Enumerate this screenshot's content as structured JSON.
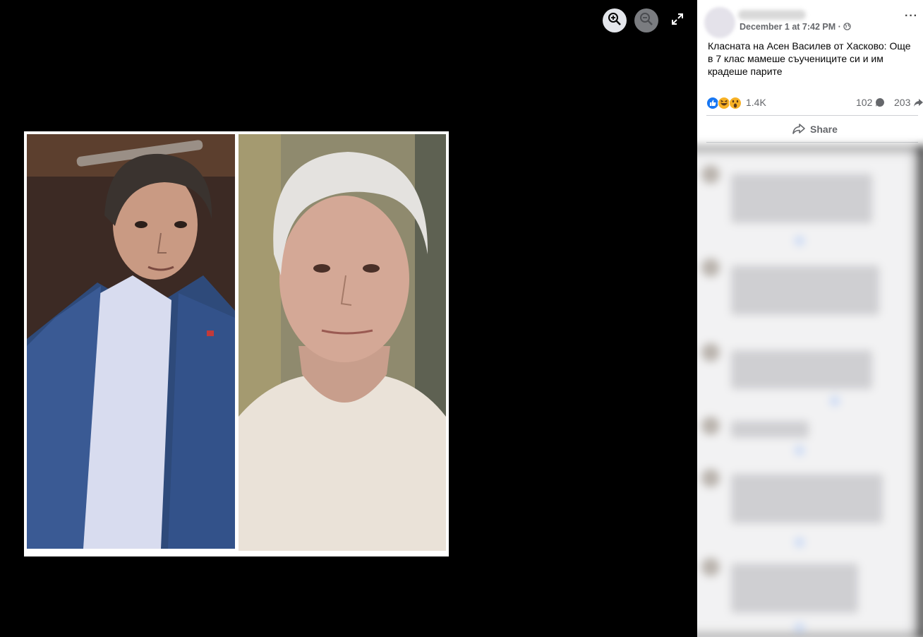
{
  "viewer": {
    "controls": [
      "zoom-in-icon",
      "zoom-out-icon",
      "fullscreen-icon"
    ]
  },
  "post": {
    "date": "December 1 at 7:42 PM",
    "visibility_separator": "·",
    "more_label": "···",
    "text": "Класната на Асен Василев от Хасково: Още в 7 клас мамеше съучениците си и им крадеше парите",
    "reactions": {
      "icons": [
        "like-icon",
        "haha-icon",
        "wow-icon"
      ],
      "count": "1.4K"
    },
    "comments_count": "102",
    "shares_count": "203",
    "share_label": "Share"
  },
  "colors": {
    "background": "#000000",
    "sidebar": "#ffffff",
    "like_blue": "#1877f2",
    "emoji_yellow": "#f7b125",
    "muted_text": "#65676b"
  }
}
